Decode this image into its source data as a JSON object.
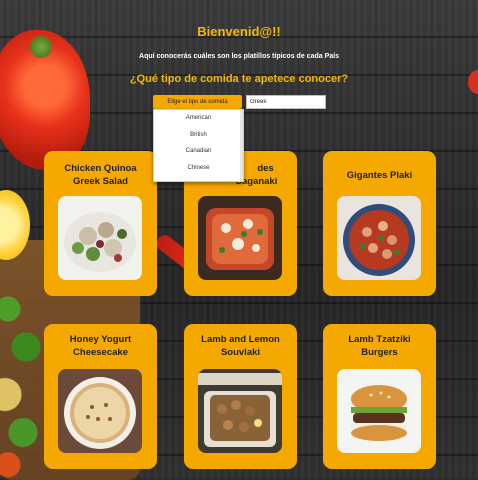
{
  "header": {
    "title": "Bienvenid@!!",
    "subtitle": "Aquí conocerás cuáles son los platillos típicos de cada País",
    "question": "¿Qué tipo de comida te apetece conocer?"
  },
  "filter": {
    "select_label": "Elige el tipo de comida",
    "search_value": "Greek",
    "options": [
      "American",
      "British",
      "Canadian",
      "Chinese"
    ]
  },
  "cards": [
    {
      "title": "Chicken Quinoa Greek Salad"
    },
    {
      "title": "Gigantes Plaki"
    },
    {
      "title": "Honey Yogurt Cheesecake"
    },
    {
      "title": "Lamb and Lemon Souvlaki"
    },
    {
      "title": "Lamb Tzatziki Burgers"
    }
  ],
  "partial_card": {
    "title_line1": "des",
    "title_line2": "Saganaki"
  },
  "colors": {
    "accent": "#f5a800",
    "title": "#f5b800"
  }
}
